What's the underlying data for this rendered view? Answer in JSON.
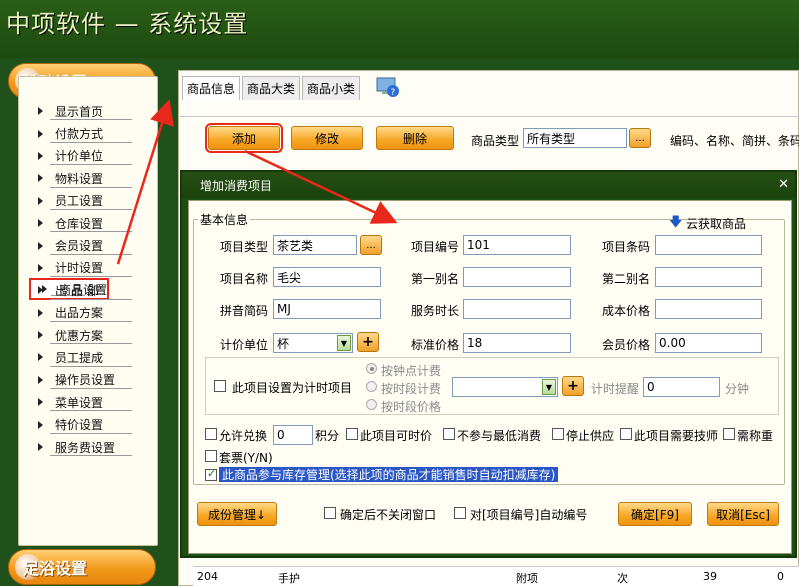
{
  "app_title": "中项软件 — 系统设置",
  "sidebar": {
    "section_top": "基础设置",
    "section_bottom": "足浴设置",
    "items": [
      "显示首页",
      "付款方式",
      "计价单位",
      "物料设置",
      "员工设置",
      "仓库设置",
      "会员设置",
      "计时设置",
      "商品设置",
      "出 品 部",
      "出品方案",
      "优惠方案",
      "员工提成",
      "操作员设置",
      "菜单设置",
      "特价设置",
      "服务费设置"
    ],
    "selected": "商品设置"
  },
  "tabs": [
    "商品信息",
    "商品大类",
    "商品小类"
  ],
  "toolbar": {
    "add": "添加",
    "edit": "修改",
    "delete": "删除",
    "type_label": "商品类型",
    "type_value": "所有类型",
    "dots": "...",
    "hint": "编码、名称、简拼、条码"
  },
  "bottom_row": {
    "code": "204",
    "name": "手护",
    "cat": "附项",
    "unit": "次",
    "num": "39",
    "zero": "0"
  },
  "dialog": {
    "title": "增加消费项目",
    "close": "✕",
    "group": "基本信息",
    "cloud": "云获取商品",
    "fields": {
      "type_label": "项目类型",
      "type_value": "茶艺类",
      "code_label": "项目编号",
      "code_value": "101",
      "barcode_label": "项目条码",
      "barcode_value": "",
      "name_label": "项目名称",
      "name_value": "毛尖",
      "alias1_label": "第一别名",
      "alias1_value": "",
      "alias2_label": "第二别名",
      "alias2_value": "",
      "pinyin_label": "拼音简码",
      "pinyin_value": "MJ",
      "duration_label": "服务时长",
      "duration_value": "",
      "cost_label": "成本价格",
      "cost_value": "",
      "unit_label": "计价单位",
      "unit_value": "杯",
      "price_label": "标准价格",
      "price_value": "18",
      "member_label": "会员价格",
      "member_value": "0.00"
    },
    "timing": {
      "checkbox": "此项目设置为计时项目",
      "r1": "按钟点计费",
      "r2": "按时段计费",
      "r3": "按时段价格",
      "remind_label": "计时提醒",
      "remind_value": "0",
      "minute": "分钟"
    },
    "options": {
      "exchange": "允许兑换",
      "exchange_value": "0",
      "points": "积分",
      "timeable": "此项目可时价",
      "no_min": "不参与最低消费",
      "stop": "停止供应",
      "tech": "此项目需要技师",
      "weigh": "需称重",
      "set": "套票(Y/N)",
      "stock": "此商品参与库存管理(选择此项的商品才能销售时自动扣减库存)"
    },
    "footer": {
      "share": "成份管理↓",
      "keep_open": "确定后不关闭窗口",
      "auto_code": "对[项目编号]自动编号",
      "ok": "确定[F9]",
      "cancel": "取消[Esc]"
    }
  },
  "colors": {
    "accent": "#f29a1b",
    "highlight": "#e8281a",
    "bg": "#1f4f12"
  }
}
